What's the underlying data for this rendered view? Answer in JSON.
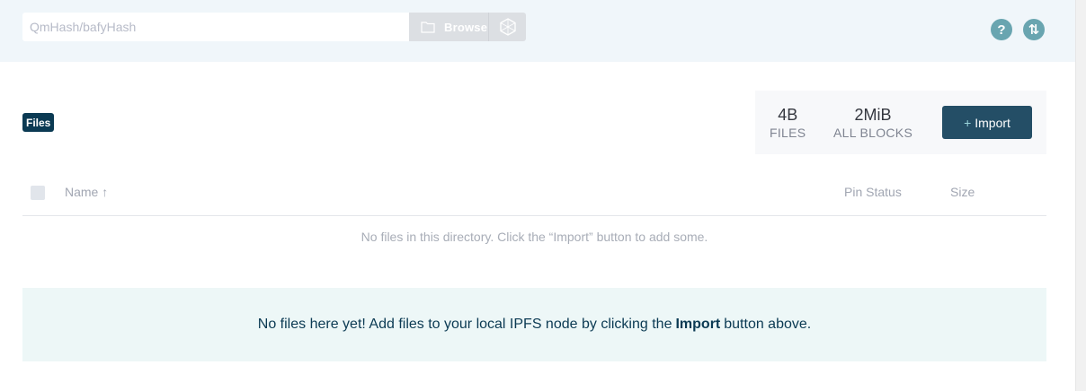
{
  "topbar": {
    "search_placeholder": "QmHash/bafyHash",
    "browse_label": "Browse",
    "help_icon": "question-mark-icon",
    "status_icon": "peers-transfer-icon",
    "help_glyph": "?",
    "status_glyph": "⇅"
  },
  "breadcrumb": {
    "label": "Files"
  },
  "stats": {
    "files_value": "4B",
    "files_label": "FILES",
    "blocks_value": "2MiB",
    "blocks_label": "ALL BLOCKS"
  },
  "import_button": {
    "plus": "+",
    "label": "Import"
  },
  "table": {
    "columns": [
      "Name ↑",
      "Pin Status",
      "Size"
    ],
    "empty_message": "No files in this directory. Click the “Import” button to add some."
  },
  "banner": {
    "before": "No files here yet! Add files to your local IPFS node by clicking the",
    "bold": "Import",
    "after": "button above."
  },
  "colors": {
    "topbar_bg": "#f0f6fa",
    "accent_dark": "#0b3a53",
    "import_bg": "#244e66",
    "icon_teal": "#69a5b0",
    "banner_bg": "#edf7f7"
  }
}
